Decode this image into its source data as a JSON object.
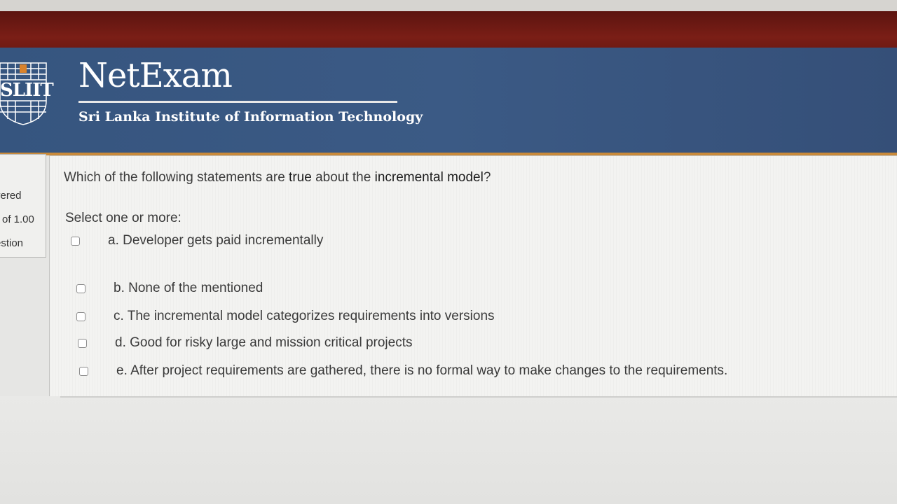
{
  "header": {
    "logo_text": "SLIIT",
    "app_name": "NetExam",
    "institute": "Sri Lanka Institute of Information Technology"
  },
  "question_info": {
    "status_partial": "vered",
    "marks_partial": "of 1.00",
    "flag_partial": "estion"
  },
  "question": {
    "text_before": "Which of the following statements are ",
    "text_true": "true",
    "text_middle": " about the ",
    "text_model": "incremental model",
    "text_end": "?",
    "instruction": "Select one or more:",
    "options": [
      {
        "label": "a. Developer gets paid incrementally",
        "checked": false
      },
      {
        "label": "b. None of the mentioned",
        "checked": false
      },
      {
        "label": "c. The incremental model categorizes requirements into versions",
        "checked": false
      },
      {
        "label": "d. Good for risky large and mission critical projects",
        "checked": false
      },
      {
        "label": "e. After project requirements are gathered, there is no formal way to make changes to the requirements.",
        "checked": false
      }
    ]
  },
  "colors": {
    "brand_bar": "#6a1812",
    "header_blue": "#3b5a85",
    "accent_orange": "#c98a3a"
  }
}
